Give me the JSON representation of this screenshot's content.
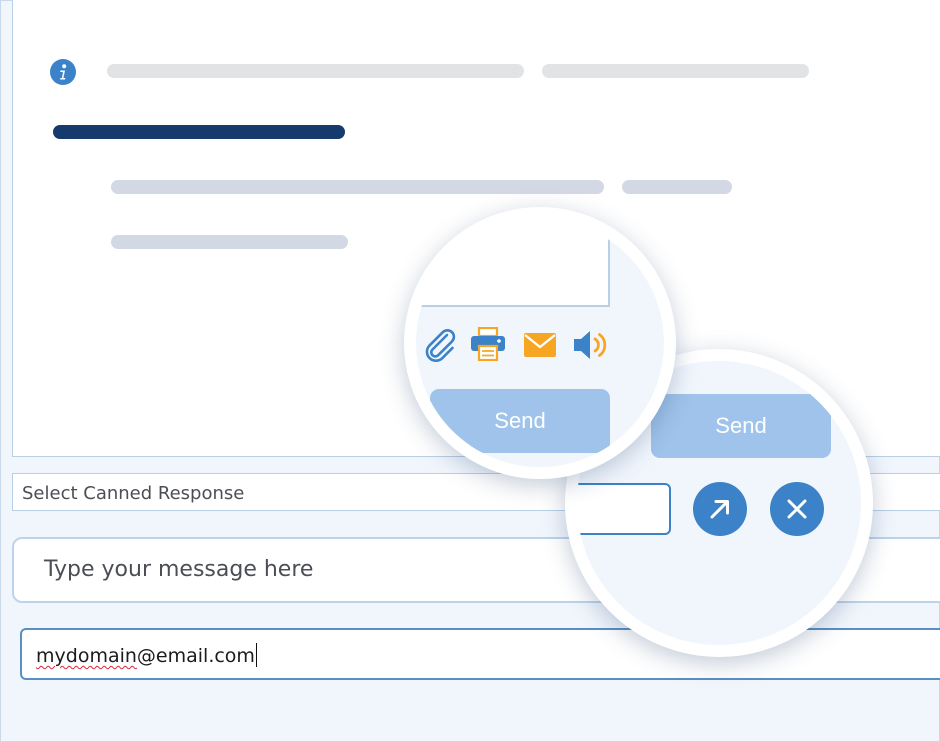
{
  "transcript": {
    "info_icon": "info-icon"
  },
  "toolbar": {
    "icons": [
      "paperclip-icon",
      "printer-icon",
      "envelope-icon",
      "speaker-icon"
    ],
    "send_label": "Send",
    "colors": {
      "accent": "#3b82c8",
      "send_bg": "#9fc3ea",
      "orange": "#f6a623"
    }
  },
  "actions": {
    "send_label": "Send",
    "popout_icon": "arrow-up-right-icon",
    "close_icon": "close-icon"
  },
  "canned": {
    "placeholder": "Select Canned Response"
  },
  "message": {
    "placeholder": "Type your message here"
  },
  "email": {
    "value_misspelled": "mydomain",
    "value_rest": "@email.com"
  }
}
